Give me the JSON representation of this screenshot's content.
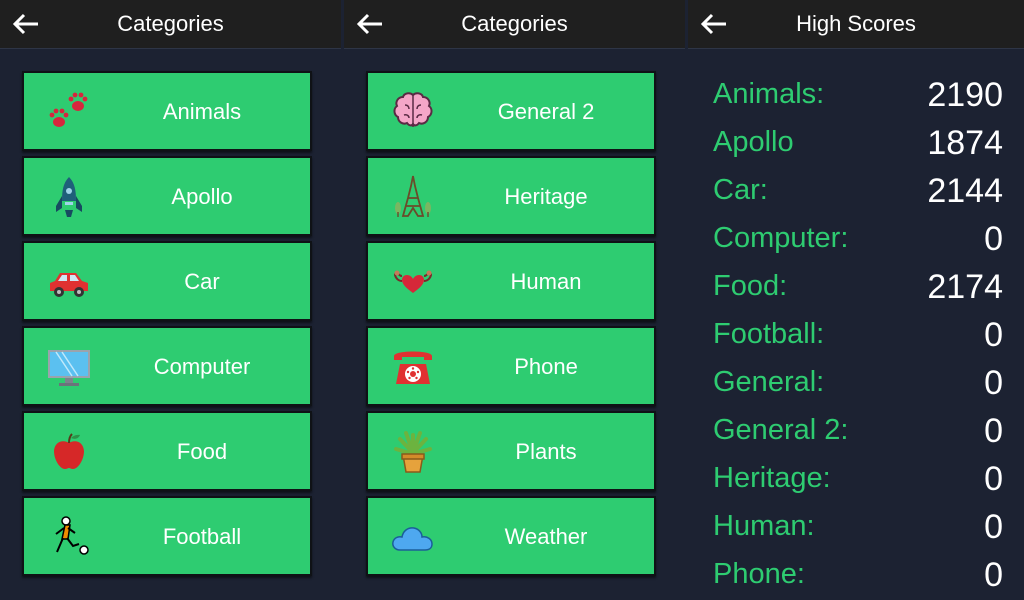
{
  "screens": [
    {
      "title": "Categories",
      "items": [
        {
          "label": "Animals",
          "icon": "paw-prints-icon"
        },
        {
          "label": "Apollo",
          "icon": "rocket-icon"
        },
        {
          "label": "Car",
          "icon": "car-icon"
        },
        {
          "label": "Computer",
          "icon": "monitor-icon"
        },
        {
          "label": "Food",
          "icon": "apple-icon"
        },
        {
          "label": "Football",
          "icon": "football-player-icon"
        }
      ]
    },
    {
      "title": "Categories",
      "items": [
        {
          "label": "General 2",
          "icon": "brain-icon"
        },
        {
          "label": "Heritage",
          "icon": "eiffel-tower-icon"
        },
        {
          "label": "Human",
          "icon": "strong-heart-icon"
        },
        {
          "label": "Phone",
          "icon": "rotary-phone-icon"
        },
        {
          "label": "Plants",
          "icon": "potted-plant-icon"
        },
        {
          "label": "Weather",
          "icon": "cloud-icon"
        }
      ]
    },
    {
      "title": "High Scores",
      "scores": [
        {
          "category": "Animals:",
          "score": "2190"
        },
        {
          "category": "Apollo",
          "score": "1874"
        },
        {
          "category": "Car:",
          "score": "2144"
        },
        {
          "category": "Computer:",
          "score": "0"
        },
        {
          "category": "Food:",
          "score": "2174"
        },
        {
          "category": "Football:",
          "score": "0"
        },
        {
          "category": "General:",
          "score": "0"
        },
        {
          "category": "General 2:",
          "score": "0"
        },
        {
          "category": "Heritage:",
          "score": "0"
        },
        {
          "category": "Human:",
          "score": "0"
        },
        {
          "category": "Phone:",
          "score": "0"
        }
      ]
    }
  ],
  "colors": {
    "accent": "#2ecc71",
    "background": "#1c2232",
    "topbar": "#1f1f1f"
  }
}
